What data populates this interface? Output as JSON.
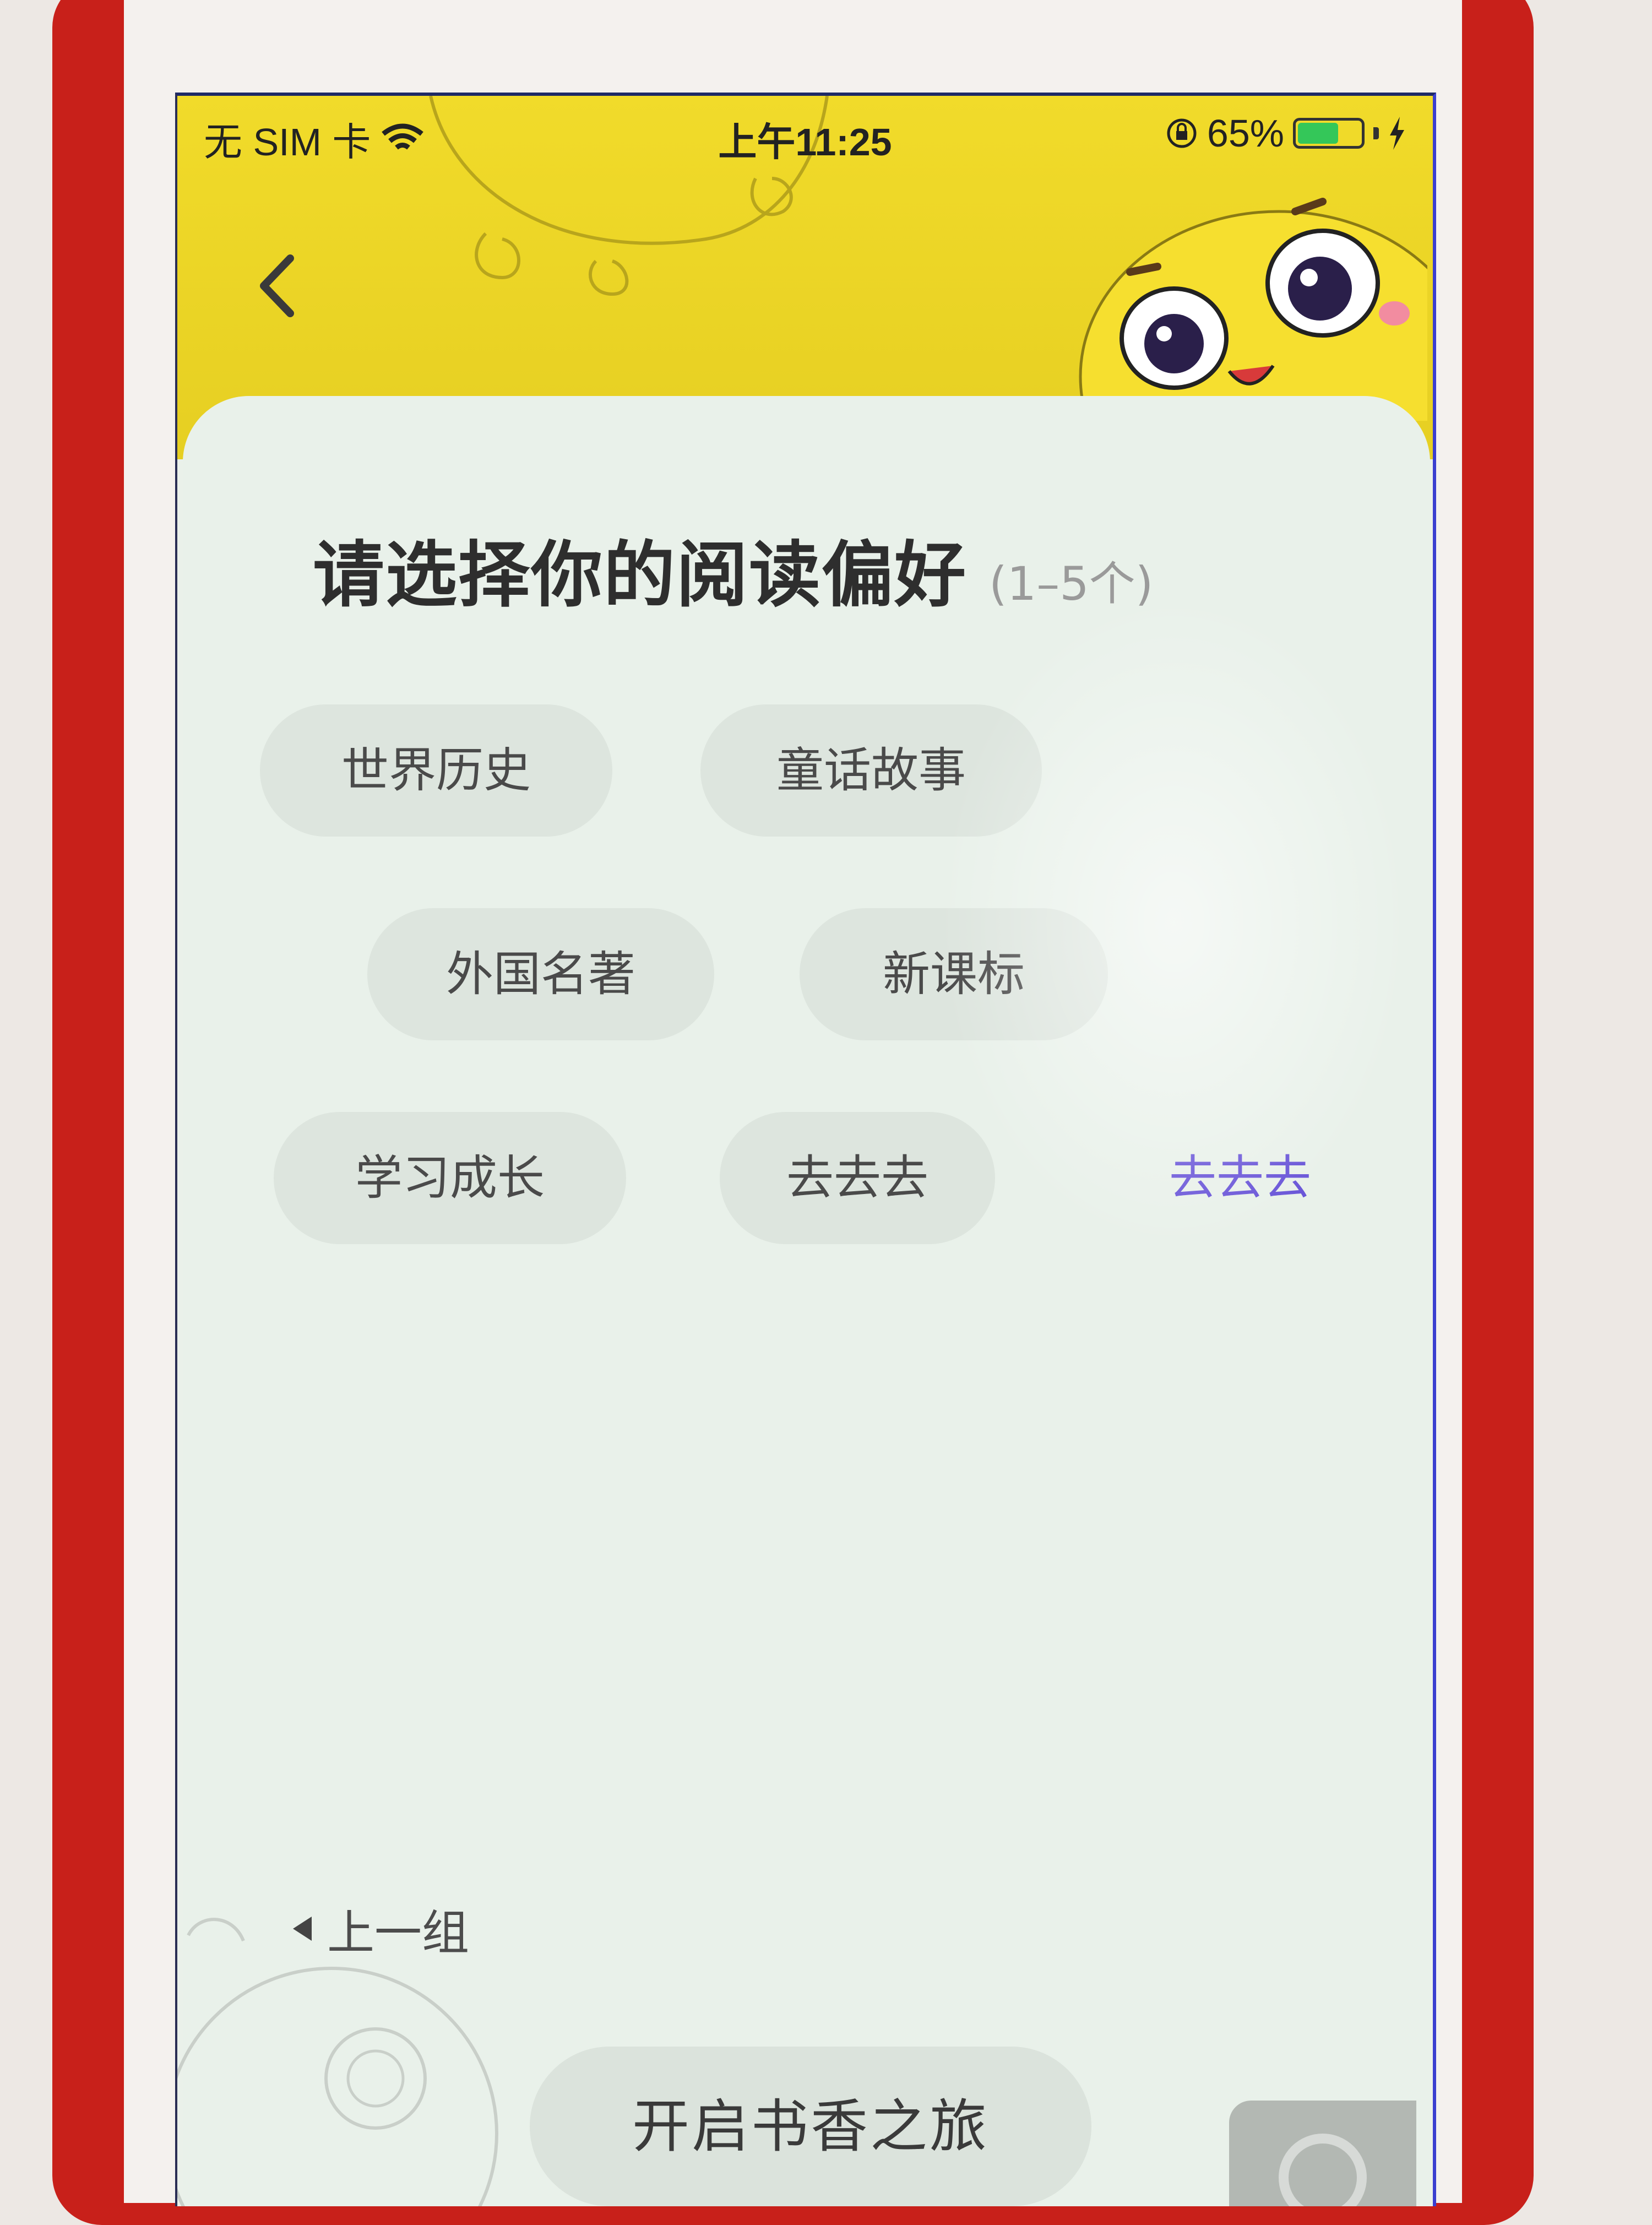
{
  "status_bar": {
    "carrier": "无 SIM 卡",
    "time": "上午11:25",
    "battery": "65%",
    "battery_level": 0.65,
    "icons": [
      "wifi-icon",
      "orientation-lock-icon",
      "battery-icon",
      "charging-icon"
    ]
  },
  "header": {
    "back_icon": "chevron-left-icon",
    "color": "#f1db2a"
  },
  "preferences": {
    "title": "请选择你的阅读偏好",
    "subtitle": "(1–5个)",
    "options": [
      {
        "label": "世界历史"
      },
      {
        "label": "童话故事"
      },
      {
        "label": "外国名著"
      },
      {
        "label": "新课标"
      },
      {
        "label": "学习成长"
      },
      {
        "label": "去去去"
      },
      {
        "label": "去去去"
      }
    ],
    "prev_group_label": "上一组",
    "start_button_label": "开启书香之旅"
  },
  "colors": {
    "card_background": "#e9f1ea",
    "chip_background": "#dde5de",
    "accent_text": "#6a56d8",
    "phone_case": "#c8201a"
  }
}
